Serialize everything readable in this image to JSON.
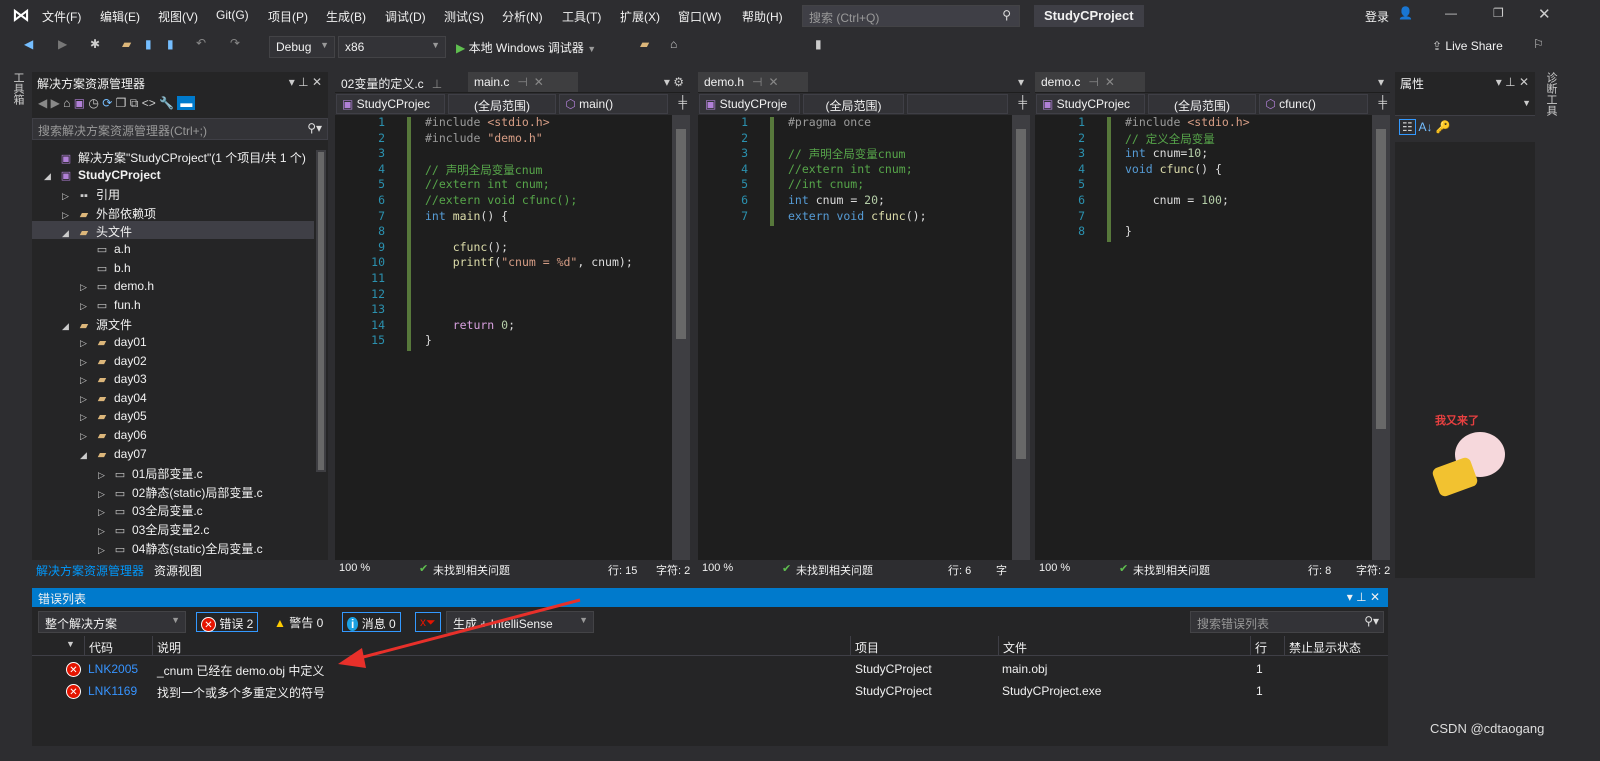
{
  "titlebar": {
    "menus": [
      "文件(F)",
      "编辑(E)",
      "视图(V)",
      "Git(G)",
      "项目(P)",
      "生成(B)",
      "调试(D)",
      "测试(S)",
      "分析(N)",
      "工具(T)",
      "扩展(X)",
      "窗口(W)",
      "帮助(H)"
    ],
    "search_placeholder": "搜索 (Ctrl+Q)",
    "project": "StudyCProject",
    "login": "登录"
  },
  "toolbar": {
    "config": "Debug",
    "platform": "x86",
    "run": "本地 Windows 调试器",
    "live_share": "Live Share"
  },
  "left_strip": "工具箱",
  "right_strip": "诊断工具",
  "solution": {
    "title": "解决方案资源管理器",
    "search_placeholder": "搜索解决方案资源管理器(Ctrl+;)",
    "items": [
      {
        "label": "解决方案\"StudyCProject\"(1 个项目/共 1 个)",
        "depth": 0,
        "exp": "",
        "icon": "solution"
      },
      {
        "label": "StudyCProject",
        "depth": 0,
        "exp": "open",
        "icon": "project",
        "bold": true
      },
      {
        "label": "引用",
        "depth": 1,
        "exp": "closed",
        "icon": "ref"
      },
      {
        "label": "外部依赖项",
        "depth": 1,
        "exp": "closed",
        "icon": "ext"
      },
      {
        "label": "头文件",
        "depth": 1,
        "exp": "open",
        "icon": "folder",
        "selected": true
      },
      {
        "label": "a.h",
        "depth": 2,
        "exp": "",
        "icon": "file"
      },
      {
        "label": "b.h",
        "depth": 2,
        "exp": "",
        "icon": "file"
      },
      {
        "label": "demo.h",
        "depth": 2,
        "exp": "closed",
        "icon": "file"
      },
      {
        "label": "fun.h",
        "depth": 2,
        "exp": "closed",
        "icon": "file"
      },
      {
        "label": "源文件",
        "depth": 1,
        "exp": "open",
        "icon": "folder"
      },
      {
        "label": "day01",
        "depth": 2,
        "exp": "closed",
        "icon": "folder"
      },
      {
        "label": "day02",
        "depth": 2,
        "exp": "closed",
        "icon": "folder"
      },
      {
        "label": "day03",
        "depth": 2,
        "exp": "closed",
        "icon": "folder"
      },
      {
        "label": "day04",
        "depth": 2,
        "exp": "closed",
        "icon": "folder"
      },
      {
        "label": "day05",
        "depth": 2,
        "exp": "closed",
        "icon": "folder"
      },
      {
        "label": "day06",
        "depth": 2,
        "exp": "closed",
        "icon": "folder"
      },
      {
        "label": "day07",
        "depth": 2,
        "exp": "open",
        "icon": "folder"
      },
      {
        "label": "01局部变量.c",
        "depth": 3,
        "exp": "closed",
        "icon": "file"
      },
      {
        "label": "02静态(static)局部变量.c",
        "depth": 3,
        "exp": "closed",
        "icon": "file"
      },
      {
        "label": "03全局变量.c",
        "depth": 3,
        "exp": "closed",
        "icon": "file"
      },
      {
        "label": "03全局变量2.c",
        "depth": 3,
        "exp": "closed",
        "icon": "file"
      },
      {
        "label": "04静态(static)全局变量.c",
        "depth": 3,
        "exp": "closed",
        "icon": "file"
      }
    ],
    "tabs": [
      "解决方案资源管理器",
      "资源视图"
    ]
  },
  "editors": [
    {
      "tabs": [
        {
          "label": "02变量的定义.c",
          "active": false
        },
        {
          "label": "main.c",
          "active": true
        }
      ],
      "nav": [
        "StudyCProjec",
        "(全局范围)",
        "main()"
      ],
      "zoom": "100 %",
      "issues": "未找到相关问题",
      "row": "行: 15",
      "col": "字符: 2",
      "lines": [
        [
          [
            "#include ",
            "pp"
          ],
          [
            "<stdio.h>",
            "str"
          ]
        ],
        [
          [
            "#include ",
            "pp"
          ],
          [
            "\"demo.h\"",
            "str"
          ]
        ],
        [],
        [
          [
            "// 声明全局变量cnum",
            "cm"
          ]
        ],
        [
          [
            "//extern int cnum;",
            "cm"
          ]
        ],
        [
          [
            "//extern void cfunc();",
            "cm"
          ]
        ],
        [
          [
            "int ",
            "kw"
          ],
          [
            "main",
            "fn"
          ],
          [
            "() {",
            "pl"
          ]
        ],
        [],
        [
          [
            "    cfunc",
            "fn"
          ],
          [
            "();",
            "pl"
          ]
        ],
        [
          [
            "    printf",
            "fn"
          ],
          [
            "(",
            "pl"
          ],
          [
            "\"cnum = %d\"",
            "str"
          ],
          [
            ", cnum);",
            "pl"
          ]
        ],
        [],
        [],
        [],
        [
          [
            "    return ",
            "ret"
          ],
          [
            "0",
            "num"
          ],
          [
            ";",
            "pl"
          ]
        ],
        [
          [
            "}",
            "pl"
          ]
        ]
      ]
    },
    {
      "tabs": [
        {
          "label": "demo.h",
          "active": true
        }
      ],
      "nav": [
        "StudyCProje",
        "(全局范围)",
        ""
      ],
      "zoom": "100 %",
      "issues": "未找到相关问题",
      "row": "行: 6",
      "col": "字",
      "lines": [
        [
          [
            "#pragma once",
            "pp"
          ]
        ],
        [],
        [
          [
            "// 声明全局变量cnum",
            "cm"
          ]
        ],
        [
          [
            "//extern int cnum;",
            "cm"
          ]
        ],
        [
          [
            "//int cnum;",
            "cm"
          ]
        ],
        [
          [
            "int ",
            "kw"
          ],
          [
            "cnum = ",
            "pl"
          ],
          [
            "20",
            "num"
          ],
          [
            ";",
            "pl"
          ]
        ],
        [
          [
            "extern void ",
            "kw"
          ],
          [
            "cfunc",
            "fn"
          ],
          [
            "();",
            "pl"
          ]
        ]
      ]
    },
    {
      "tabs": [
        {
          "label": "demo.c",
          "active": true
        }
      ],
      "nav": [
        "StudyCProjec",
        "(全局范围)",
        "cfunc()"
      ],
      "zoom": "100 %",
      "issues": "未找到相关问题",
      "row": "行: 8",
      "col": "字符: 2",
      "lines": [
        [
          [
            "#include ",
            "pp"
          ],
          [
            "<stdio.h>",
            "str"
          ]
        ],
        [
          [
            "// 定义全局变量",
            "cm"
          ]
        ],
        [
          [
            "int ",
            "kw"
          ],
          [
            "cnum=",
            "pl"
          ],
          [
            "10",
            "num"
          ],
          [
            ";",
            "pl"
          ]
        ],
        [
          [
            "void ",
            "kw"
          ],
          [
            "cfunc",
            "fn"
          ],
          [
            "() {",
            "pl"
          ]
        ],
        [],
        [
          [
            "    cnum = ",
            "pl"
          ],
          [
            "100",
            "num"
          ],
          [
            ";",
            "pl"
          ]
        ],
        [],
        [
          [
            "}",
            "pl"
          ]
        ]
      ]
    }
  ],
  "properties": {
    "title": "属性"
  },
  "errors": {
    "title": "错误列表",
    "scope": "整个解决方案",
    "err_btn": "错误 2",
    "warn_btn": "警告 0",
    "msg_btn": "消息 0",
    "source": "生成 + IntelliSense",
    "search_placeholder": "搜索错误列表",
    "columns": [
      "代码",
      "说明",
      "项目",
      "文件",
      "行",
      "禁止显示状态"
    ],
    "rows": [
      {
        "code": "LNK2005",
        "desc": "_cnum 已经在 demo.obj 中定义",
        "project": "StudyCProject",
        "file": "main.obj",
        "line": "1"
      },
      {
        "code": "LNK1169",
        "desc": "找到一个或多个多重定义的符号",
        "project": "StudyCProject",
        "file": "StudyCProject.exe",
        "line": "1"
      }
    ]
  },
  "watermark": "CSDN @cdtaogang",
  "colors": {
    "accent": "#007acc",
    "error": "#e51400",
    "arrow": "#e8302a"
  }
}
